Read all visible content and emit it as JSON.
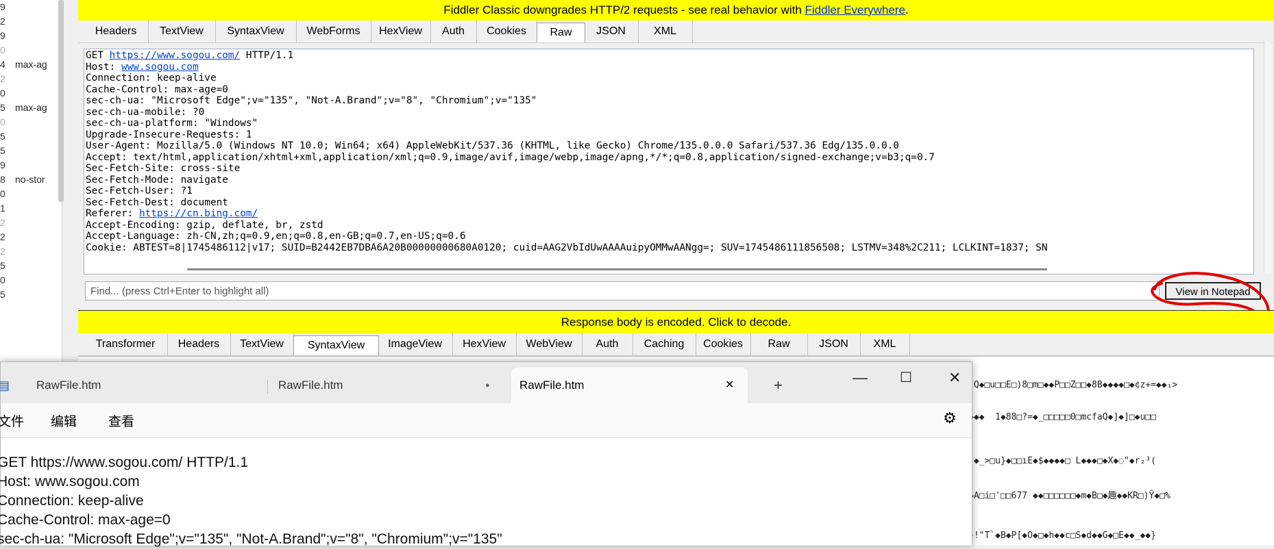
{
  "sessions": [
    {
      "num": "9",
      "cc": ""
    },
    {
      "num": "2",
      "cc": ""
    },
    {
      "num": "9",
      "cc": ""
    },
    {
      "num": "0",
      "cc": "",
      "faded": true
    },
    {
      "num": "4",
      "cc": "max-ag"
    },
    {
      "num": "2",
      "cc": "",
      "faded": true
    },
    {
      "num": "0",
      "cc": ""
    },
    {
      "num": "5",
      "cc": "max-ag"
    },
    {
      "num": "0",
      "cc": "",
      "faded": true
    },
    {
      "num": "5",
      "cc": ""
    },
    {
      "num": "5",
      "cc": ""
    },
    {
      "num": "9",
      "cc": ""
    },
    {
      "num": "8",
      "cc": "no-stor"
    },
    {
      "num": "0",
      "cc": ""
    },
    {
      "num": "1",
      "cc": ""
    },
    {
      "num": "2",
      "cc": "",
      "faded": true
    },
    {
      "num": "2",
      "cc": ""
    },
    {
      "num": "2",
      "cc": "",
      "faded": true
    },
    {
      "num": "5",
      "cc": ""
    },
    {
      "num": "0",
      "cc": ""
    },
    {
      "num": "5",
      "cc": ""
    }
  ],
  "banner_top": {
    "text": "Fiddler Classic downgrades HTTP/2 requests - see real behavior with ",
    "link": "Fiddler Everywhere",
    "suffix": "."
  },
  "request_tabs": [
    "Headers",
    "TextView",
    "SyntaxView",
    "WebForms",
    "HexView",
    "Auth",
    "Cookies",
    "Raw",
    "JSON",
    "XML"
  ],
  "request_active_tab": "Raw",
  "raw_request": {
    "first_prefix": "GET ",
    "first_url": "https://www.sogou.com/",
    "first_suffix": " HTTP/1.1",
    "host_prefix": "Host: ",
    "host_url": "www.sogou.com",
    "lines_a": [
      "Connection: keep-alive",
      "Cache-Control: max-age=0",
      "sec-ch-ua: \"Microsoft Edge\";v=\"135\", \"Not-A.Brand\";v=\"8\", \"Chromium\";v=\"135\"",
      "sec-ch-ua-mobile: ?0",
      "sec-ch-ua-platform: \"Windows\"",
      "Upgrade-Insecure-Requests: 1",
      "User-Agent: Mozilla/5.0 (Windows NT 10.0; Win64; x64) AppleWebKit/537.36 (KHTML, like Gecko) Chrome/135.0.0.0 Safari/537.36 Edg/135.0.0.0",
      "Accept: text/html,application/xhtml+xml,application/xml;q=0.9,image/avif,image/webp,image/apng,*/*;q=0.8,application/signed-exchange;v=b3;q=0.7",
      "Sec-Fetch-Site: cross-site",
      "Sec-Fetch-Mode: navigate",
      "Sec-Fetch-User: ?1",
      "Sec-Fetch-Dest: document"
    ],
    "referer_prefix": "Referer: ",
    "referer_url": "https://cn.bing.com/",
    "lines_b": [
      "Accept-Encoding: gzip, deflate, br, zstd",
      "Accept-Language: zh-CN,zh;q=0.9,en;q=0.8,en-GB;q=0.7,en-US;q=0.6",
      "Cookie: ABTEST=8|1745486112|v17; SUID=B2442EB7DBA6A20B00000000680A0120; cuid=AAG2VbIdUwAAAAuipyOMMwAANgg=; SUV=1745486111856508; LSTMV=348%2C211; LCLKINT=1837; SN"
    ]
  },
  "find_placeholder": "Find... (press Ctrl+Enter to highlight all)",
  "view_in_notepad": "View in Notepad",
  "banner_response": "Response body is encoded. Click to decode.",
  "response_tabs": [
    "Transformer",
    "Headers",
    "TextView",
    "SyntaxView",
    "ImageView",
    "HexView",
    "WebView",
    "Auth",
    "Caching",
    "Cookies",
    "Raw",
    "JSON",
    "XML"
  ],
  "response_active_tab": "SyntaxView",
  "response_garbled": [
    "]Q◆□u□□E□)8□m□◆◆P□□Z□□◆8B◆◆◆◆□◆¢z+=◆◆₁>",
    "◆◆◆  1◆88□?=◆_□□□□□0□mcfaQ◆]◆]□◆u□□",
    "]◆_>□u}◆□□ıE◆$◆◆◆◆□ L◆◆◆□◆X◆◌\"◆r₂³(",
    "◆A□i□'□□677 ◆◆□□□□□□◆m◆B□◆趣◆◆KR□)Ŷ◆□%",
    "§!\"T`◆B◆P[◆O◆□◆h◆◆c□S◆d◆◆G◆□E◆◆_◆◆}"
  ],
  "notepad": {
    "tabs": [
      "RawFile.htm",
      "RawFile.htm",
      "RawFile.htm"
    ],
    "active_tab_index": 2,
    "menu": [
      "文件",
      "编辑",
      "查看"
    ],
    "lines": [
      "GET https://www.sogou.com/ HTTP/1.1",
      "Host: www.sogou.com",
      "Connection: keep-alive",
      "Cache-Control: max-age=0",
      "sec-ch-ua: \"Microsoft Edge\";v=\"135\", \"Not-A.Brand\";v=\"8\", \"Chromium\";v=\"135\""
    ],
    "controls": {
      "minimize": "—",
      "maximize": "☐",
      "close": "✕",
      "new_tab": "+",
      "tab_close": "✕",
      "modified_dot": "●",
      "settings": "⚙"
    }
  },
  "colors": {
    "banner": "#ffff00",
    "link": "#0044dd",
    "annotation": "#e00000"
  }
}
